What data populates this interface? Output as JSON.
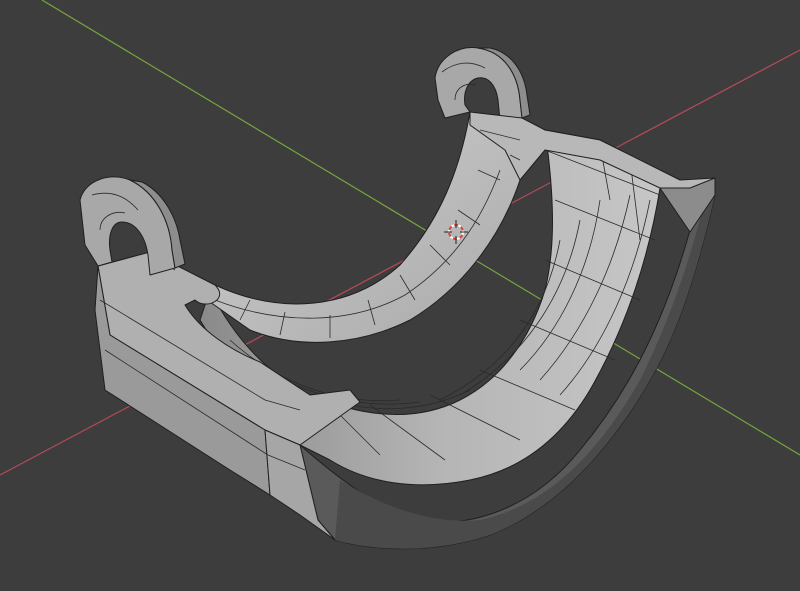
{
  "viewport": {
    "background": "#3d3d3d",
    "x_axis_color": "#b84b59",
    "y_axis_color": "#74a63d"
  },
  "model": {
    "name": "bearing-shell-mesh",
    "face_light": "#c3c3c3",
    "face_mid": "#9a9a9a",
    "face_dark": "#5f5f5f",
    "face_darkest": "#4a4a4a",
    "edge_color": "#1f1f1f"
  },
  "cursor": {
    "icon": "3d-cursor-icon"
  }
}
